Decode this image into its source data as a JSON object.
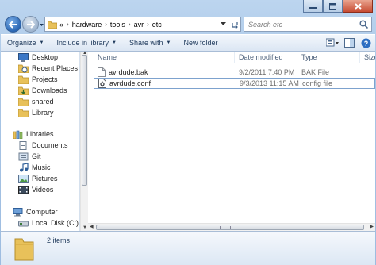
{
  "window": {
    "minimize_icon": "minimize-icon",
    "maximize_icon": "maximize-icon",
    "close_icon": "close-icon"
  },
  "address_bar": {
    "overflow": "«",
    "breadcrumbs": [
      "hardware",
      "tools",
      "avr",
      "etc"
    ]
  },
  "search": {
    "placeholder": "Search etc"
  },
  "toolbar": {
    "organize": "Organize",
    "include_in_library": "Include in library",
    "share_with": "Share with",
    "new_folder": "New folder"
  },
  "nav": {
    "favorites": [
      "Desktop",
      "Recent Places",
      "Projects",
      "Downloads",
      "shared",
      "Library"
    ],
    "libraries_header": "Libraries",
    "libraries": [
      "Documents",
      "Git",
      "Music",
      "Pictures",
      "Videos"
    ],
    "computer_header": "Computer",
    "computer": [
      "Local Disk (C:)"
    ]
  },
  "columns": {
    "name": "Name",
    "date_modified": "Date modified",
    "type": "Type",
    "size": "Size"
  },
  "files": [
    {
      "name": "avrdude.bak",
      "date": "9/2/2011 7:40 PM",
      "type": "BAK File"
    },
    {
      "name": "avrdude.conf",
      "date": "9/3/2013 11:15 AM",
      "type": "config file"
    }
  ],
  "status": {
    "item_count": "2 items"
  },
  "colors": {
    "accent": "#2a66b3",
    "folder": "#e8c15a"
  }
}
